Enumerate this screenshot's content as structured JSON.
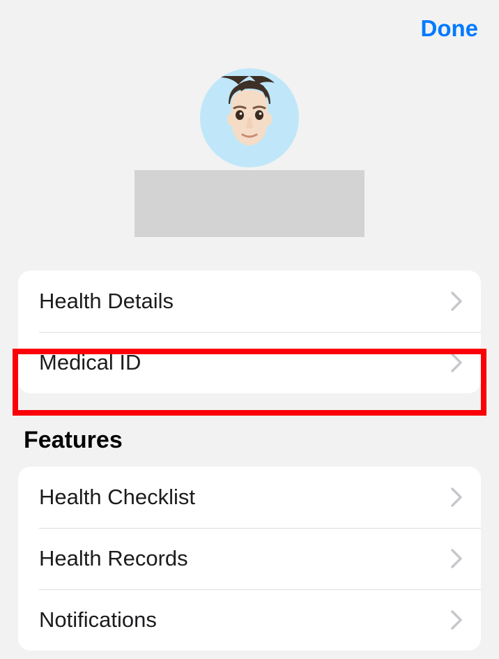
{
  "topbar": {
    "done_label": "Done"
  },
  "profile_group": {
    "items": [
      {
        "label": "Health Details"
      },
      {
        "label": "Medical ID"
      }
    ]
  },
  "features_section": {
    "title": "Features",
    "items": [
      {
        "label": "Health Checklist"
      },
      {
        "label": "Health Records"
      },
      {
        "label": "Notifications"
      }
    ]
  }
}
